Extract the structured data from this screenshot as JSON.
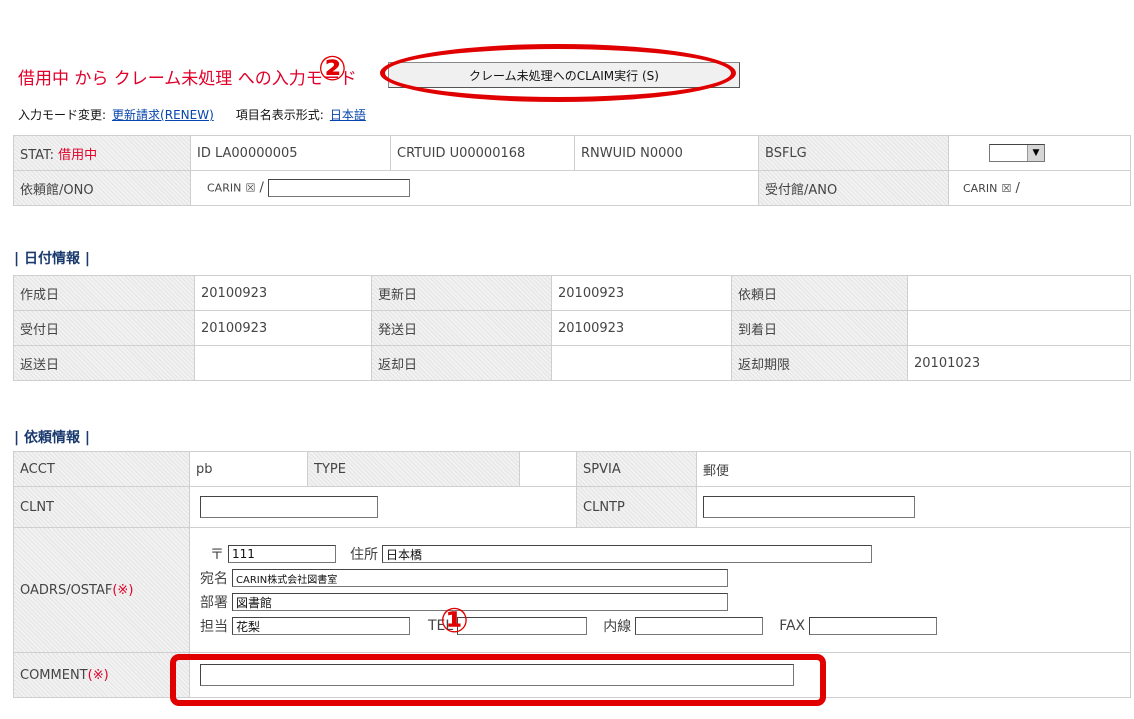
{
  "header": {
    "title": "借用中 から クレーム未処理 への入力モード",
    "claim_button": "クレーム未処理へのCLAIM実行 (S)",
    "mode_change_label": "入力モード変更:",
    "mode_change_link": "更新請求(RENEW)",
    "field_format_label": "項目名表示形式:",
    "field_format_link": "日本語"
  },
  "summary": {
    "stat_label": "STAT:",
    "stat_value": "借用中",
    "id": "ID LA00000005",
    "crtuid": "CRTUID U00000168",
    "rnwuid": "RNWUID N0000",
    "bsflg_label": "BSFLG",
    "bsflg_value": "",
    "ono_label": "依頼館/ONO",
    "ono_prefix": "CARIN",
    "ono_value": "",
    "ano_label": "受付館/ANO",
    "ano_prefix": "CARIN",
    "checkbox_glyph": "☒",
    "slash": "/"
  },
  "dates": {
    "heading": "| 日付情報 |",
    "rows": [
      [
        {
          "l": "作成日",
          "v": "20100923"
        },
        {
          "l": "更新日",
          "v": "20100923"
        },
        {
          "l": "依頼日",
          "v": ""
        }
      ],
      [
        {
          "l": "受付日",
          "v": "20100923"
        },
        {
          "l": "発送日",
          "v": "20100923"
        },
        {
          "l": "到着日",
          "v": ""
        }
      ],
      [
        {
          "l": "返送日",
          "v": ""
        },
        {
          "l": "返却日",
          "v": ""
        },
        {
          "l": "返却期限",
          "v": "20101023"
        }
      ]
    ]
  },
  "request": {
    "heading": "| 依頼情報 |",
    "acct_label": "ACCT",
    "acct_value": "pb",
    "type_label": "TYPE",
    "type_value": "",
    "spvia_label": "SPVIA",
    "spvia_value": "郵便",
    "clnt_label": "CLNT",
    "clnt_value": "",
    "clntp_label": "CLNTP",
    "clntp_value": "",
    "oadrs_label": "OADRS/OSTAF",
    "required_mark": "(※)",
    "postal_label": "〒",
    "postal_value": "111",
    "address_label": "住所",
    "address_value": "日本橋",
    "recipient_label": "宛名",
    "recipient_value": "CARIN株式会社図書室",
    "dept_label": "部署",
    "dept_value": "図書館",
    "person_label": "担当",
    "person_value": "花梨",
    "tel_label": "TEL",
    "tel_value": "",
    "ext_label": "内線",
    "ext_value": "",
    "fax_label": "FAX",
    "fax_value": "",
    "comment_label": "COMMENT",
    "comment_value": ""
  },
  "annotations": {
    "marker_1": "①",
    "marker_2": "②",
    "color": "#e00000"
  }
}
